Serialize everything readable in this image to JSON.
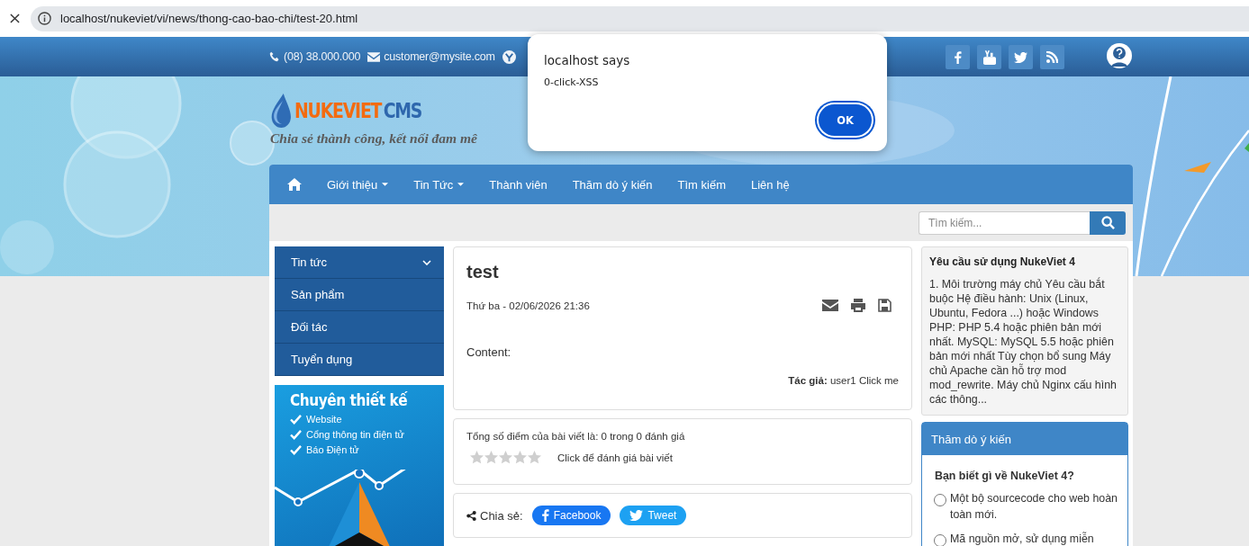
{
  "browser": {
    "url": "localhost/nukeviet/vi/news/thong-cao-bao-chi/test-20.html"
  },
  "topbar": {
    "contacts": [
      {
        "kind": "phone",
        "text": "(08) 38.000.000"
      },
      {
        "kind": "email",
        "text": "customer@mysite.com"
      },
      {
        "kind": "messenger"
      }
    ],
    "social": [
      {
        "kind": "facebook"
      },
      {
        "kind": "youtube"
      },
      {
        "kind": "twitter"
      },
      {
        "kind": "rss"
      }
    ]
  },
  "logo": {
    "brand": "NUKEVIET",
    "suffix": "CMS",
    "slogan": "Chia sẻ thành công, kết nối đam mê"
  },
  "nav": [
    {
      "kind": "home"
    },
    {
      "kind": "link",
      "label": "Giới thiệu",
      "dropdown": true
    },
    {
      "kind": "link",
      "label": "Tin Tức",
      "dropdown": true
    },
    {
      "kind": "link",
      "label": "Thành viên",
      "dropdown": false
    },
    {
      "kind": "link",
      "label": "Thăm dò ý kiến",
      "dropdown": false
    },
    {
      "kind": "link",
      "label": "Tìm kiếm",
      "dropdown": false
    },
    {
      "kind": "link",
      "label": "Liên hệ",
      "dropdown": false
    }
  ],
  "search": {
    "placeholder": "Tìm kiếm..."
  },
  "left_menu": [
    {
      "label": "Tin tức",
      "expandable": true
    },
    {
      "label": "Sản phẩm",
      "expandable": false
    },
    {
      "label": "Đối tác",
      "expandable": false
    },
    {
      "label": "Tuyển dụng",
      "expandable": false
    }
  ],
  "banner": {
    "title": "Chuyên thiết kế",
    "items": [
      "Website",
      "Cổng thông tin điện tử",
      "Báo Điện tử"
    ]
  },
  "article": {
    "title": "test",
    "date": "Thứ ba - 02/06/2026 21:36",
    "content": "Content:",
    "author_label": "Tác giả:",
    "author": "user1 Click me"
  },
  "rating": {
    "summary": "Tổng số điểm của bài viết là: 0 trong 0 đánh giá",
    "stars": 0,
    "hint": "Click để đánh giá bài viết"
  },
  "share": {
    "label": "Chia sẻ:",
    "buttons": [
      {
        "kind": "facebook",
        "label": "Facebook"
      },
      {
        "kind": "twitter",
        "label": "Tweet"
      }
    ]
  },
  "sidebar_block": {
    "title": "Yêu cầu sử dụng NukeViet 4",
    "text": "1. Môi trường máy chủ Yêu cầu bắt buộc Hệ điều hành: Unix (Linux, Ubuntu, Fedora ...) hoặc Windows PHP: PHP 5.4 hoặc phiên bản mới nhất. MySQL: MySQL 5.5 hoặc phiên bản mới nhất Tùy chọn bổ sung Máy chủ Apache cần hỗ trợ mod mod_rewrite. Máy chủ Nginx cấu hình các thông..."
  },
  "poll": {
    "heading": "Thăm dò ý kiến",
    "question": "Bạn biết gì về NukeViet 4?",
    "options": [
      {
        "label": "Một bộ sourcecode cho web hoàn toàn mới.",
        "selected": false
      },
      {
        "label": "Mã nguồn mở, sử dụng miễn",
        "selected": false
      }
    ]
  },
  "dialog": {
    "title": "localhost says",
    "message": "0-click-XSS",
    "button": "OK"
  }
}
